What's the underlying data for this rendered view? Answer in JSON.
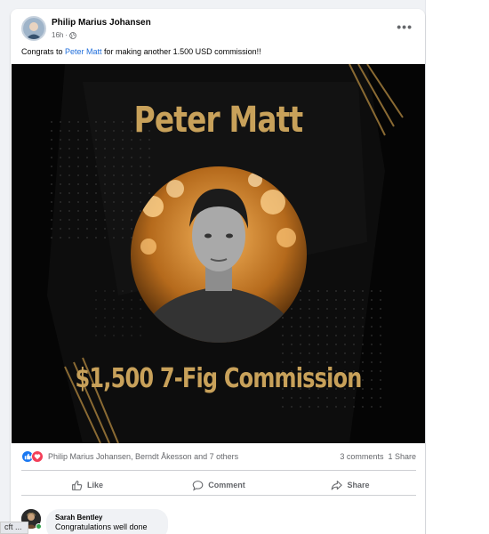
{
  "post": {
    "author": "Philip Marius Johansen",
    "time": "16h",
    "text_prefix": "Congrats to ",
    "mention": "Peter Matt",
    "text_suffix": " for making another 1.500 USD commission!!",
    "more_icon": "more-dots-icon"
  },
  "media": {
    "title": "Peter Matt",
    "caption": "$1,500 7-Fig Commission"
  },
  "reactions": {
    "icons": [
      "like-icon",
      "love-icon"
    ],
    "names": "Philip Marius Johansen, Berndt Åkesson and 7 others",
    "comments": "3 comments",
    "shares": "1 Share"
  },
  "actions": {
    "like": "Like",
    "comment": "Comment",
    "share": "Share"
  },
  "comment": {
    "author": "Sarah Bentley",
    "text": "Congratulations well done"
  },
  "bottom_tab": "cft ...",
  "colors": {
    "accent": "#216fdb",
    "gold": "#c8a15a",
    "like_blue": "#1877f2",
    "love_red": "#f33e58"
  }
}
